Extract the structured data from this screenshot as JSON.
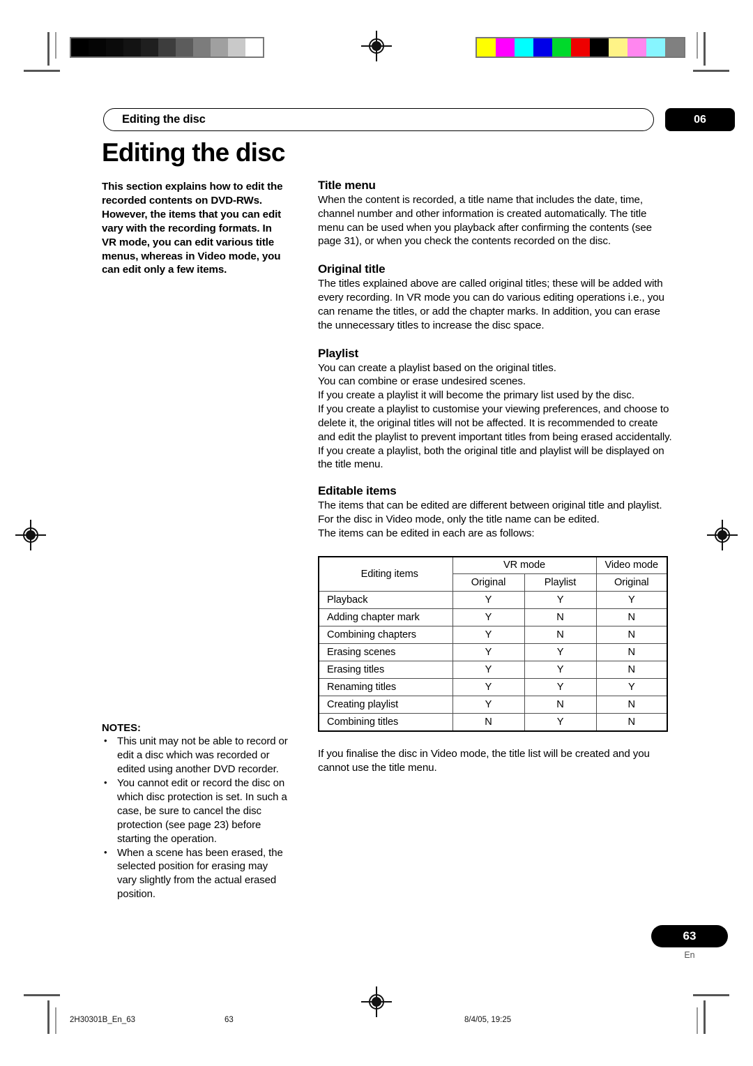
{
  "header": {
    "running_title": "Editing the disc",
    "chapter_badge": "06"
  },
  "page_title": "Editing the disc",
  "intro": "This section explains how to edit the recorded contents on DVD-RWs. However, the items that you can edit vary with the recording formats. In VR mode, you can edit various title menus, whereas in Video mode, you can edit only a few items.",
  "notes": {
    "title": "NOTES:",
    "bullet_glyph": "•",
    "items": [
      "This unit may not be able to record or edit a disc which was recorded or edited using another DVD recorder.",
      "You cannot edit or record the disc on which disc protection is set. In such a case, be sure to cancel the disc protection (see page 23) before starting the operation.",
      "When a scene has been erased, the selected position for erasing may vary slightly from the actual erased position."
    ]
  },
  "sections": [
    {
      "heading": "Title menu",
      "body": "When the content is recorded, a title name that includes the date, time, channel number and other information is created automatically. The title menu can be used when you playback after confirming the contents (see page 31), or when you check the contents recorded on the disc."
    },
    {
      "heading": "Original title",
      "body": "The titles explained above are called original titles; these will be added with every recording. In VR mode you can do various editing operations i.e., you can rename the titles, or add the chapter marks. In addition, you can erase the unnecessary titles to increase the disc space."
    },
    {
      "heading": "Playlist",
      "body_1": "You can create a playlist based on the original titles.",
      "body_2": "You can combine or erase undesired scenes.",
      "body_3": "If you create a playlist it will become the primary list used by the disc.",
      "body_4": "If you create a playlist to customise your viewing preferences, and choose to delete it, the original titles will not be affected. It is recommended to create and edit the playlist to prevent important titles from being erased accidentally.",
      "body_5": "If you create a playlist, both the original title and playlist will be displayed on the title menu."
    },
    {
      "heading": "Editable items",
      "body_1": "The items that can be edited are different between original title and playlist. For the disc in Video mode, only the title name can be edited.",
      "body_2": "The items can be edited in each are as follows:"
    }
  ],
  "table": {
    "header_item": "Editing items",
    "header_vr_mode": "VR mode",
    "header_video_mode": "Video mode",
    "sub_original_vr": "Original",
    "sub_playlist": "Playlist",
    "sub_original_video": "Original",
    "rows": [
      {
        "item": "Playback",
        "vr_original": "Y",
        "vr_playlist": "Y",
        "video_original": "Y"
      },
      {
        "item": "Adding chapter mark",
        "vr_original": "Y",
        "vr_playlist": "N",
        "video_original": "N"
      },
      {
        "item": "Combining chapters",
        "vr_original": "Y",
        "vr_playlist": "N",
        "video_original": "N"
      },
      {
        "item": "Erasing scenes",
        "vr_original": "Y",
        "vr_playlist": "Y",
        "video_original": "N"
      },
      {
        "item": "Erasing titles",
        "vr_original": "Y",
        "vr_playlist": "Y",
        "video_original": "N"
      },
      {
        "item": "Renaming titles",
        "vr_original": "Y",
        "vr_playlist": "Y",
        "video_original": "Y"
      },
      {
        "item": "Creating playlist",
        "vr_original": "Y",
        "vr_playlist": "N",
        "video_original": "N"
      },
      {
        "item": "Combining titles",
        "vr_original": "N",
        "vr_playlist": "Y",
        "video_original": "N"
      }
    ]
  },
  "after_table": "If you finalise the disc in Video mode, the title list will be created and you cannot use the title menu.",
  "page_number": {
    "number": "63",
    "language": "En"
  },
  "footer": {
    "file_name": "2H30301B_En_63",
    "page": "63",
    "date": "8/4/05, 19:25"
  },
  "calibration": {
    "greyscale_swatches": [
      "#000000",
      "#050505",
      "#0b0b0b",
      "#131313",
      "#1f1f1f",
      "#3d3d3d",
      "#5c5c5c",
      "#7c7c7c",
      "#a0a0a0",
      "#c9c9c9",
      "#ffffff"
    ],
    "color_swatches": [
      "#ffff00",
      "#ff00ff",
      "#00ffff",
      "#0000e8",
      "#00d92b",
      "#ee0000",
      "#000000",
      "#fff387",
      "#ff86ef",
      "#87f5ff",
      "#808080"
    ]
  }
}
